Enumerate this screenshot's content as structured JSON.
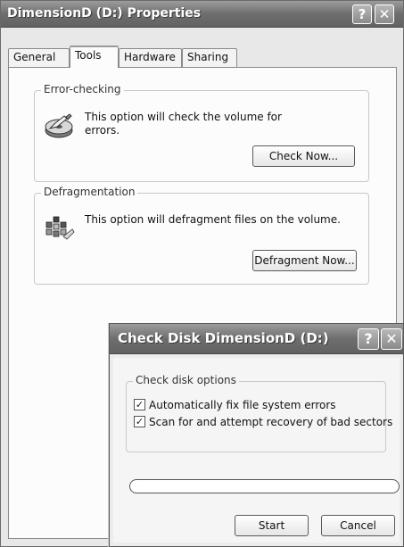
{
  "properties_window": {
    "title": "DimensionD (D:) Properties",
    "help_glyph": "?",
    "close_glyph": "✕",
    "tabs": [
      {
        "label": "General",
        "active": false
      },
      {
        "label": "Tools",
        "active": true
      },
      {
        "label": "Hardware",
        "active": false
      },
      {
        "label": "Sharing",
        "active": false
      }
    ],
    "error_checking": {
      "group_label": "Error-checking",
      "description_line1": "This option will check the volume for",
      "description_line2": "errors.",
      "button_label": "Check Now...",
      "icon": "disk-check-icon"
    },
    "defragmentation": {
      "group_label": "Defragmentation",
      "description": "This option will defragment files on the volume.",
      "button_label": "Defragment Now...",
      "icon": "defragment-icon"
    }
  },
  "check_disk_dialog": {
    "title": "Check Disk DimensionD (D:)",
    "help_glyph": "?",
    "close_glyph": "✕",
    "options_group_label": "Check disk options",
    "options": [
      {
        "label": "Automatically fix file system errors",
        "checked": true
      },
      {
        "label": "Scan for and attempt recovery of bad sectors",
        "checked": true
      }
    ],
    "progress": 0,
    "start_label": "Start",
    "cancel_label": "Cancel"
  },
  "colors": {
    "titlebar": "#6e6e6e",
    "window_face": "#e8e8e8",
    "panel": "#fcfcfc"
  }
}
